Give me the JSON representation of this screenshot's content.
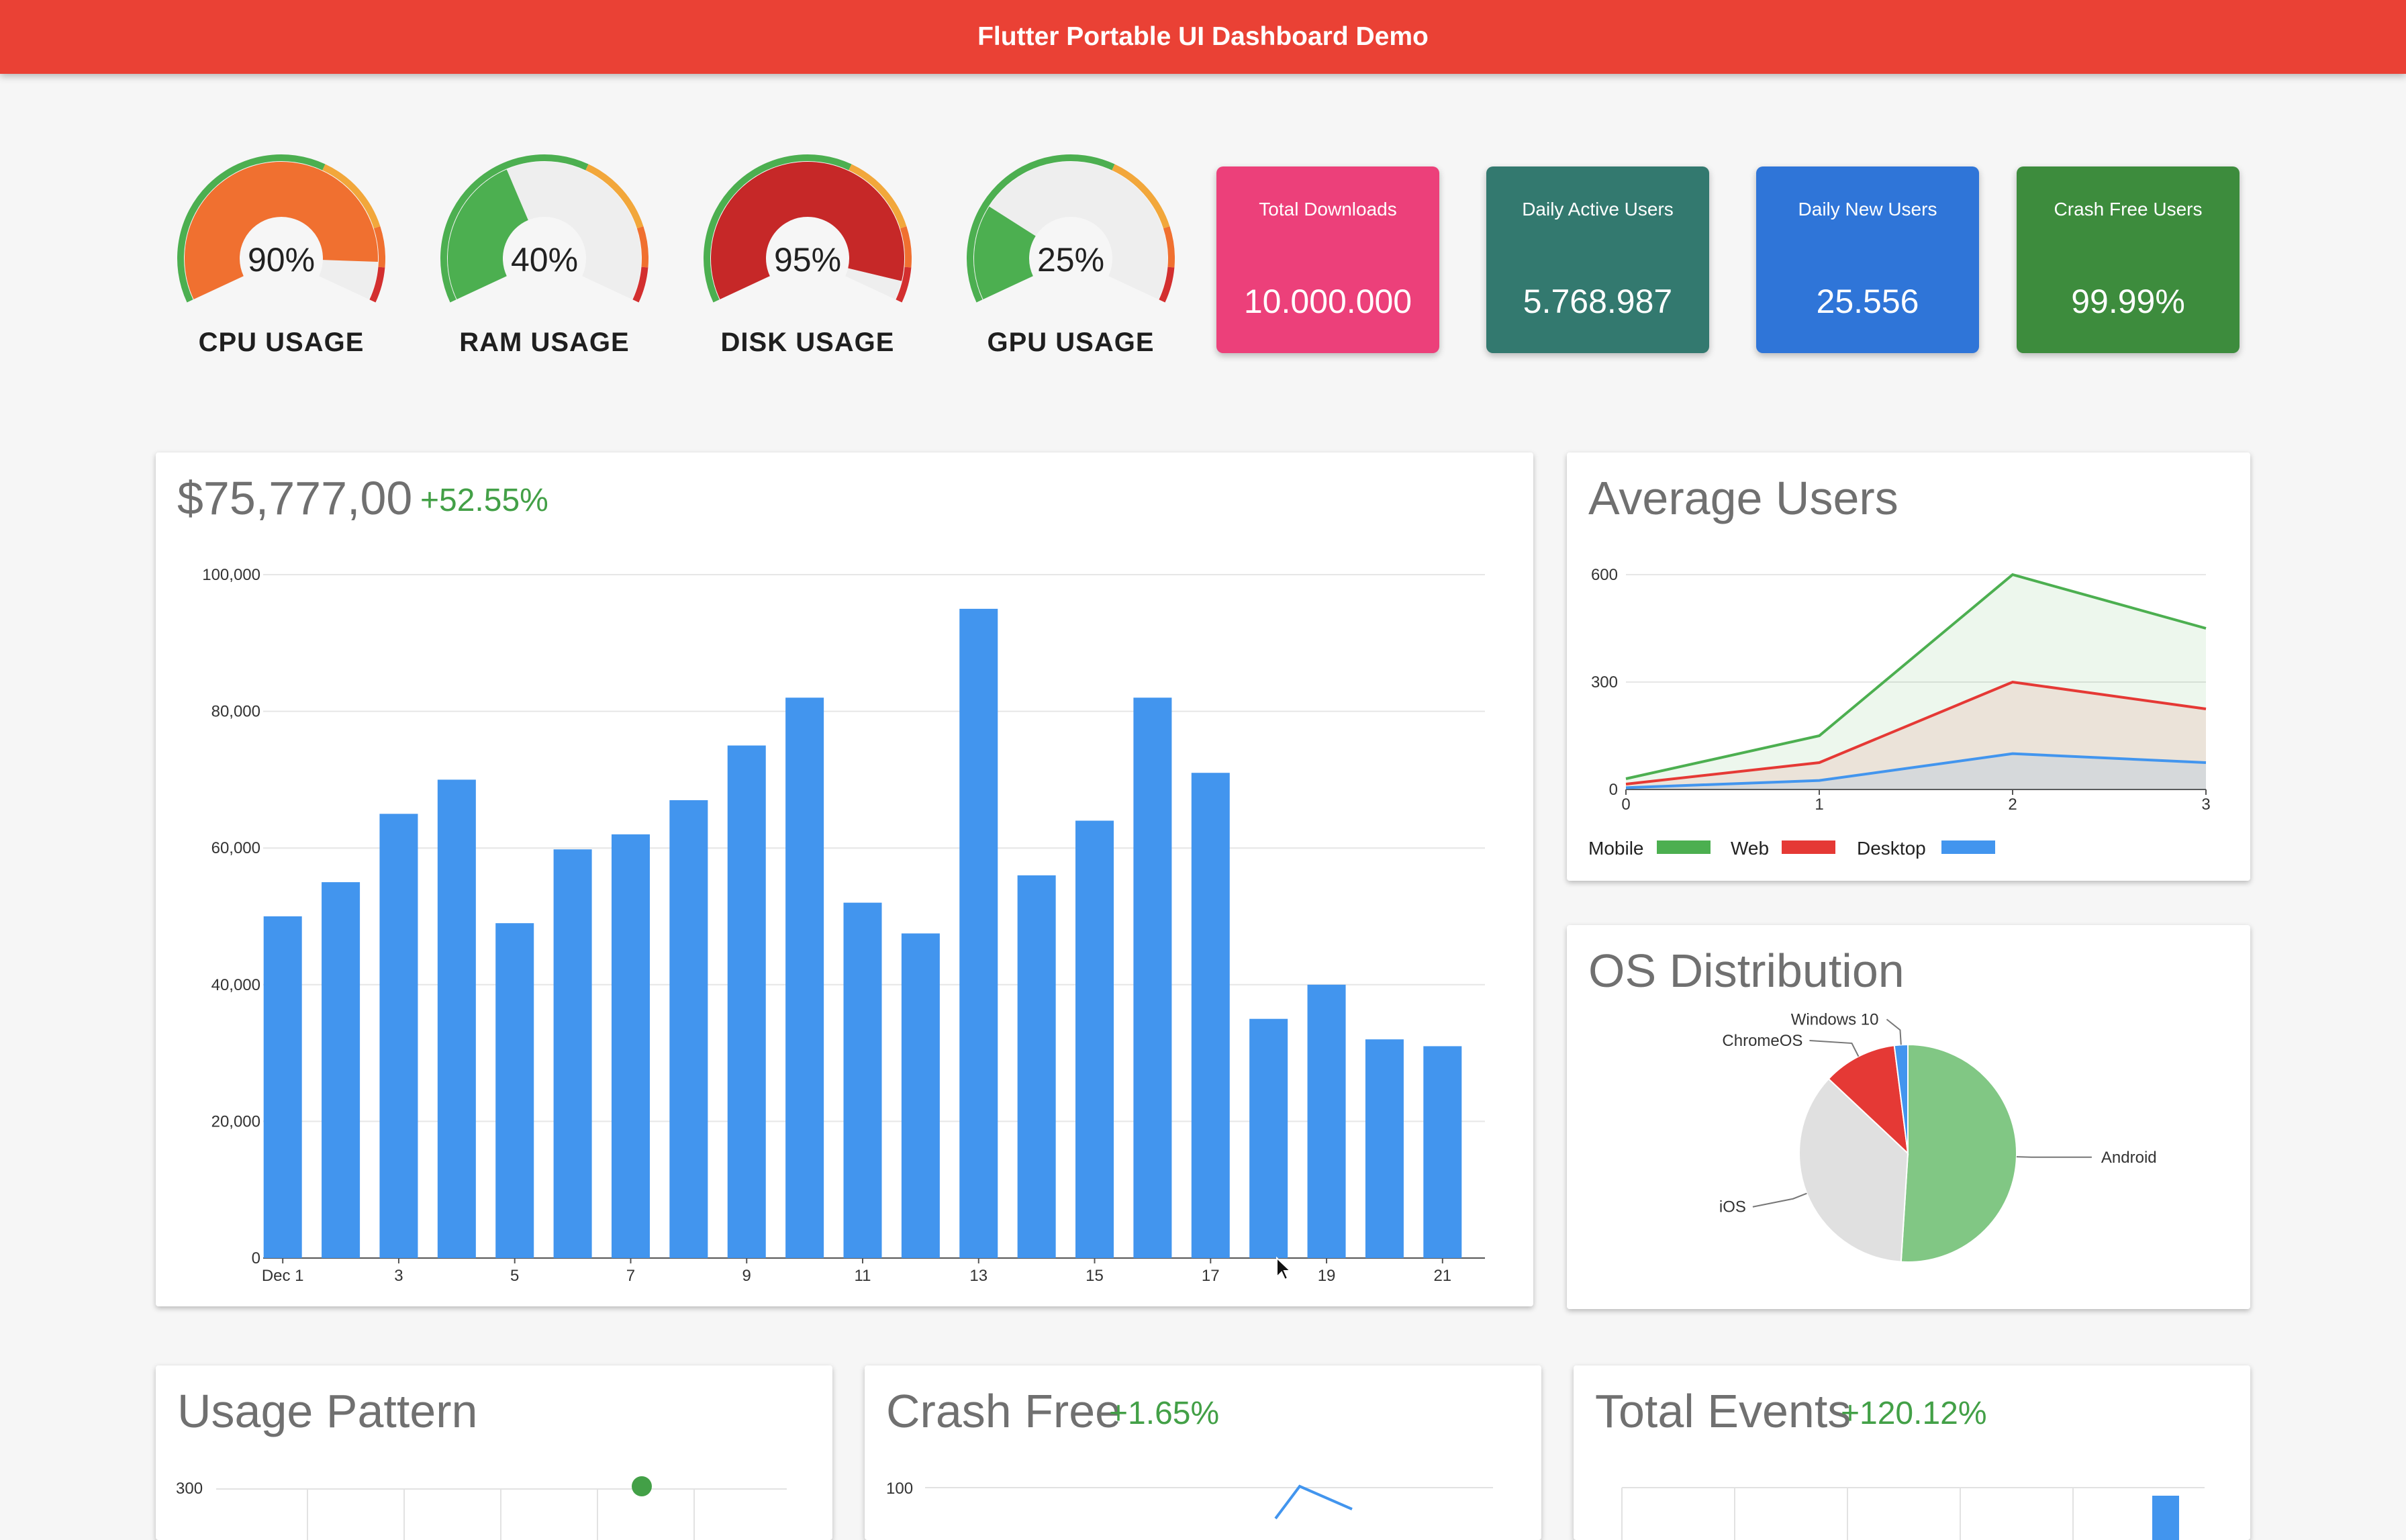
{
  "app": {
    "title": "Flutter Portable UI Dashboard Demo"
  },
  "colors": {
    "appbar": "#ea4135",
    "bar": "#4295ee",
    "positive": "#43a047",
    "mobile": "#4caf50",
    "web": "#e53935",
    "desktop": "#4295ee"
  },
  "gauges": [
    {
      "label": "CPU USAGE",
      "value_text": "90%",
      "value": 0.9,
      "fill_color": "#f07030"
    },
    {
      "label": "RAM USAGE",
      "value_text": "40%",
      "value": 0.4,
      "fill_color": "#4caf50"
    },
    {
      "label": "DISK USAGE",
      "value_text": "95%",
      "value": 0.95,
      "fill_color": "#c62828"
    },
    {
      "label": "GPU USAGE",
      "value_text": "25%",
      "value": 0.25,
      "fill_color": "#4caf50"
    }
  ],
  "stats": [
    {
      "label": "Total Downloads",
      "value": "10.000.000",
      "color": "#ec407a"
    },
    {
      "label": "Daily Active Users",
      "value": "5.768.987",
      "color": "#33796f"
    },
    {
      "label": "Daily New Users",
      "value": "25.556",
      "color": "#2f75d8"
    },
    {
      "label": "Crash Free Users",
      "value": "99.99%",
      "color": "#3d8c3d"
    }
  ],
  "revenue": {
    "amount": "$75,777,00",
    "delta": "+52.55%",
    "chart_data": {
      "type": "bar",
      "x": [
        1,
        2,
        3,
        4,
        5,
        6,
        7,
        8,
        9,
        10,
        11,
        12,
        13,
        14,
        15,
        16,
        17,
        18,
        19,
        20,
        21
      ],
      "values": [
        50000,
        55000,
        65000,
        70000,
        49000,
        59800,
        62000,
        67000,
        75000,
        82000,
        52000,
        47500,
        95000,
        56000,
        64000,
        82000,
        71000,
        35000,
        40000,
        32000,
        31000
      ],
      "tick_labels": [
        "Dec 1",
        "3",
        "5",
        "7",
        "9",
        "11",
        "13",
        "15",
        "17",
        "19",
        "21"
      ],
      "tick_positions": [
        1,
        3,
        5,
        7,
        9,
        11,
        13,
        15,
        17,
        19,
        21
      ],
      "y_ticks": [
        "0",
        "20,000",
        "40,000",
        "60,000",
        "80,000",
        "100,000"
      ],
      "ylim": [
        0,
        100000
      ],
      "grid": true
    }
  },
  "average_users": {
    "title": "Average Users",
    "chart_data": {
      "type": "area",
      "x": [
        0,
        1,
        2,
        3
      ],
      "series": [
        {
          "name": "Mobile",
          "values": [
            30,
            150,
            600,
            450
          ]
        },
        {
          "name": "Web",
          "values": [
            15,
            75,
            300,
            225
          ]
        },
        {
          "name": "Desktop",
          "values": [
            5,
            25,
            100,
            75
          ]
        }
      ],
      "x_ticks": [
        "0",
        "1",
        "2",
        "3"
      ],
      "y_ticks": [
        "0",
        "300",
        "600"
      ],
      "ylim": [
        0,
        600
      ],
      "legend_position": "bottom"
    }
  },
  "os_distribution": {
    "title": "OS Distribution",
    "chart_data": {
      "type": "pie",
      "slices": [
        {
          "label": "Android",
          "value": 51,
          "color": "#81c784"
        },
        {
          "label": "iOS",
          "value": 36,
          "color": "#e0e0e0"
        },
        {
          "label": "ChromeOS",
          "value": 11,
          "color": "#e53935"
        },
        {
          "label": "Windows 10",
          "value": 2,
          "color": "#4295ee"
        }
      ]
    }
  },
  "usage_pattern": {
    "title": "Usage Pattern",
    "y_top": "300"
  },
  "crash_free": {
    "title": "Crash Free",
    "delta": "+1.65%",
    "y_top": "100"
  },
  "total_events": {
    "title": "Total Events",
    "delta": "+120.12%"
  }
}
